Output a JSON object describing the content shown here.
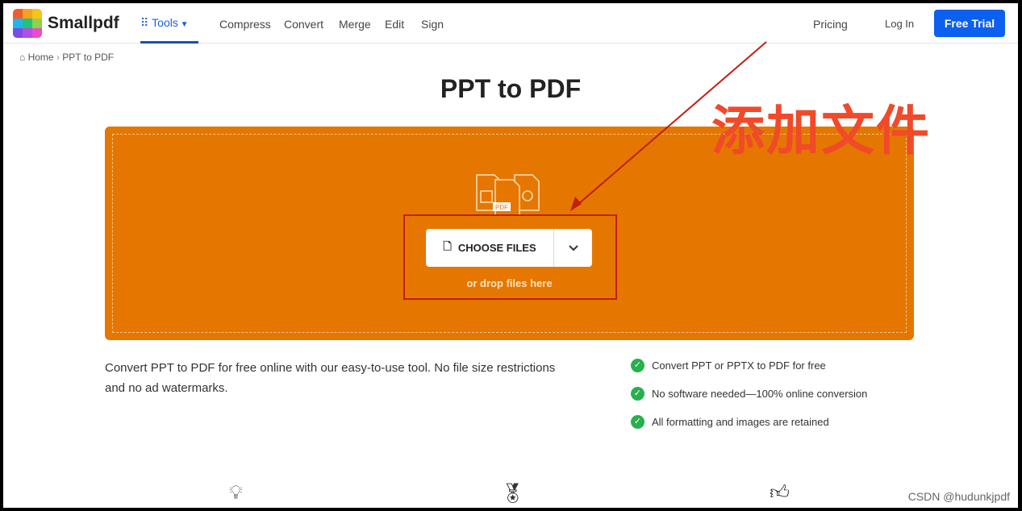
{
  "nav": {
    "brand": "Smallpdf",
    "tools": "Tools",
    "links": [
      "Compress",
      "Convert",
      "Merge",
      "Edit",
      "Sign"
    ],
    "pricing": "Pricing",
    "login": "Log In",
    "trial": "Free Trial"
  },
  "breadcrumb": {
    "home": "Home",
    "sep": "›",
    "current": "PPT to PDF"
  },
  "title": "PPT to PDF",
  "dropzone": {
    "choose": "CHOOSE FILES",
    "or_drop": "or drop files here",
    "pdf_label": "PDF",
    "color": "#e57700"
  },
  "annotation": "添加文件",
  "description": "Convert PPT to PDF for free online with our easy-to-use tool. No file size restrictions and no ad watermarks.",
  "features": [
    "Convert PPT or PPTX to PDF for free",
    "No software needed—100% online conversion",
    "All formatting and images are retained"
  ],
  "watermark": "CSDN @hudunkjpdf"
}
